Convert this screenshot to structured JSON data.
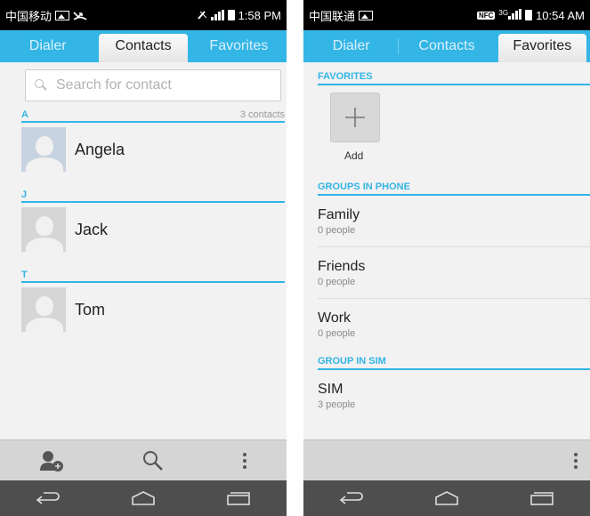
{
  "left": {
    "status": {
      "carrier": "中国移动",
      "time": "1:58 PM"
    },
    "tabs": [
      "Dialer",
      "Contacts",
      "Favorites"
    ],
    "search": {
      "placeholder": "Search for contact"
    },
    "sections": [
      {
        "letter": "A",
        "count": "3 contacts",
        "contacts": [
          {
            "name": "Angela",
            "selected": true
          }
        ]
      },
      {
        "letter": "J",
        "count": "",
        "contacts": [
          {
            "name": "Jack",
            "selected": false
          }
        ]
      },
      {
        "letter": "T",
        "count": "",
        "contacts": [
          {
            "name": "Tom",
            "selected": false
          }
        ]
      }
    ],
    "bottom_actions": [
      "add-contact-icon",
      "search-icon",
      "overflow-menu-icon"
    ]
  },
  "right": {
    "status": {
      "carrier": "中国联通",
      "network": "3G",
      "time": "10:54 AM"
    },
    "tabs": [
      "Dialer",
      "Contacts",
      "Favorites"
    ],
    "favorites_header": "FAVORITES",
    "add_label": "Add",
    "groups_in_phone_header": "GROUPS IN PHONE",
    "groups_in_phone": [
      {
        "name": "Family",
        "count": "0 people"
      },
      {
        "name": "Friends",
        "count": "0 people"
      },
      {
        "name": "Work",
        "count": "0 people"
      }
    ],
    "group_in_sim_header": "GROUP IN SIM",
    "groups_in_sim": [
      {
        "name": "SIM",
        "count": "3 people"
      }
    ],
    "bottom_actions": [
      "overflow-menu-icon"
    ]
  },
  "colors": {
    "accent": "#33b5e5",
    "status_bar": "#000000",
    "nav_bar": "#4e4e4e",
    "bottom_bar": "#d5d5d5"
  }
}
